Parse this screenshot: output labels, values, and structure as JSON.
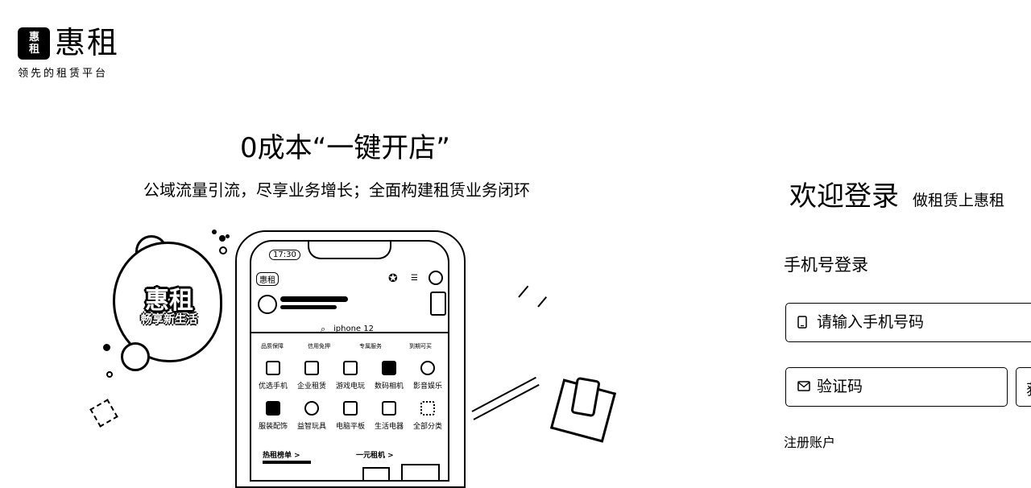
{
  "brand": {
    "logo_text_line1": "惠",
    "logo_text_line2": "租",
    "name": "惠租",
    "tagline": "领先的租赁平台"
  },
  "promo": {
    "title": "0成本“一键开店”",
    "subtitle": "公域流量引流，尽享业务增长；全面构建租赁业务闭环",
    "mascot_title": "惠租",
    "mascot_subtitle": "畅享新生活"
  },
  "phone_mock": {
    "time": "17:30",
    "brand": "惠租",
    "search_text": "iphone 12",
    "perks": [
      "品质保障",
      "信用免押",
      "专属服务",
      "到期可买"
    ],
    "categories_row1": [
      "优选手机",
      "企业租赁",
      "游戏电玩",
      "数码相机",
      "影音娱乐"
    ],
    "categories_row2": [
      "服装配饰",
      "益智玩具",
      "电脑平板",
      "生活电器",
      "全部分类"
    ],
    "section_left": "热租榜单 >",
    "section_right": "一元租机 >"
  },
  "login": {
    "title": "欢迎登录",
    "slogan": "做租赁上惠租",
    "method": "手机号登录",
    "phone_placeholder": "请输入手机号码",
    "code_placeholder": "验证码",
    "code_button": "获",
    "register": "注册账户"
  },
  "colors": {
    "background": "#ffffff",
    "foreground": "#000000"
  },
  "icons": [
    "phone-icon",
    "mail-icon",
    "search-icon",
    "star-icon",
    "bell-icon"
  ]
}
